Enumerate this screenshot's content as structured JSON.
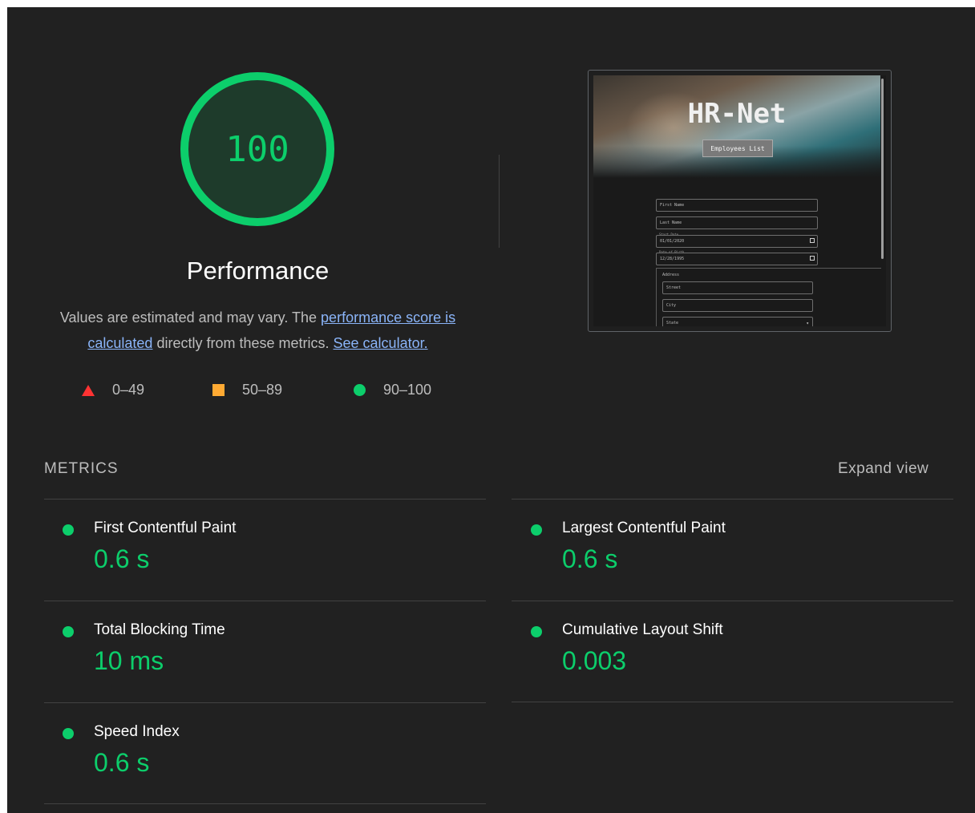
{
  "gauge": {
    "score": "100",
    "fraction": 1.0,
    "color": "#0cce6b"
  },
  "category": {
    "title": "Performance",
    "desc_prefix": "Values are estimated and may vary. The ",
    "score_link": "performance score is calculated",
    "desc_middle": " directly from these metrics. ",
    "calc_link": "See calculator."
  },
  "legend": {
    "fail": {
      "range": "0–49",
      "color": "#ff3333"
    },
    "average": {
      "range": "50–89",
      "color": "#ffaa33"
    },
    "pass": {
      "range": "90–100",
      "color": "#0cce6b"
    }
  },
  "preview": {
    "app_title": "HR-Net",
    "nav_button": "Employees List",
    "fields": {
      "first_name": "First Name",
      "last_name": "Last Name",
      "start_date_label": "Start Date",
      "start_date_value": "01/01/2020",
      "dob_label": "Date of Birth",
      "dob_value": "12/28/1995",
      "address_legend": "Address",
      "street": "Street",
      "city": "City",
      "state": "State"
    }
  },
  "metrics": {
    "title": "METRICS",
    "expand_label": "Expand view",
    "items": [
      {
        "label": "First Contentful Paint",
        "value": "0.6 s"
      },
      {
        "label": "Largest Contentful Paint",
        "value": "0.6 s"
      },
      {
        "label": "Total Blocking Time",
        "value": "10 ms"
      },
      {
        "label": "Cumulative Layout Shift",
        "value": "0.003"
      },
      {
        "label": "Speed Index",
        "value": "0.6 s"
      }
    ]
  }
}
